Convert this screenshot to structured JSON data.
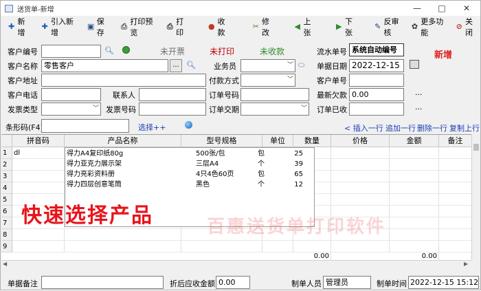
{
  "window": {
    "title": "送货单-新增",
    "minimize": "—",
    "maximize": "□",
    "close": "✕"
  },
  "toolbar": [
    {
      "label": "新增",
      "icon": "plus-icon",
      "glyph": "✚",
      "color": "#1a5fb4"
    },
    {
      "label": "引入新增",
      "icon": "import-plus-icon",
      "glyph": "✚",
      "color": "#1a5fb4"
    },
    {
      "label": "保存",
      "icon": "save-icon",
      "glyph": "▣",
      "color": "#2b4f8a"
    },
    {
      "label": "打印预览",
      "icon": "print-preview-icon",
      "glyph": "⎙",
      "color": "#555555"
    },
    {
      "label": "打印",
      "icon": "print-icon",
      "glyph": "⎙",
      "color": "#333333"
    },
    {
      "label": "收款",
      "icon": "collect-payment-icon",
      "glyph": "●",
      "color": "#c0392b"
    },
    {
      "label": "修改",
      "icon": "edit-icon",
      "glyph": "✂",
      "color": "#8a6d1a"
    },
    {
      "label": "上张",
      "icon": "previous-icon",
      "glyph": "◀",
      "color": "#2e8b2e"
    },
    {
      "label": "下张",
      "icon": "next-icon",
      "glyph": "▶",
      "color": "#2e8b2e"
    },
    {
      "label": "反审核",
      "icon": "unaudit-icon",
      "glyph": "✎",
      "color": "#1a3f7a"
    },
    {
      "label": "更多功能",
      "icon": "more-functions-icon",
      "glyph": "✿",
      "color": "#333333"
    },
    {
      "label": "关闭",
      "icon": "close-icon",
      "glyph": "⊘",
      "color": "#c0392b"
    }
  ],
  "form": {
    "customer_code_label": "客户编号",
    "customer_code": "",
    "invoice_status": "未开票",
    "print_status": "未打印",
    "payment_status": "未收款",
    "serial_label": "流水单号",
    "serial_value": "系统自动编号",
    "mode_badge": "新增",
    "customer_name_label": "客户名称",
    "customer_name": "零售客户",
    "browse_label": "...",
    "salesperson_label": "业务员",
    "salesperson": "",
    "date_label": "单据日期",
    "date_value": "2022-12-15",
    "customer_address_label": "客户地址",
    "customer_address": "",
    "payment_method_label": "付款方式",
    "payment_method": "",
    "customer_order_label": "客户单号",
    "customer_order": "",
    "customer_phone_label": "客户电话",
    "customer_phone": "",
    "contact_label": "联系人",
    "contact": "",
    "order_no_label": "订单号码",
    "order_no": "",
    "latest_debt_label": "最新欠款",
    "latest_debt": "0.00",
    "invoice_type_label": "发票类型",
    "invoice_type": "",
    "invoice_no_label": "发票号码",
    "invoice_no": "",
    "delivery_date_label": "订单交期",
    "delivery_date": "",
    "order_received_label": "订单已收",
    "order_received": "",
    "barcode_label": "条形码(F4)",
    "barcode": "",
    "select_more": "选择++",
    "insert_row": "< 插入一行",
    "append_row": "追加一行",
    "delete_row": "删除一行",
    "copy_up": "复制上行"
  },
  "grid": {
    "columns": [
      "拼音码",
      "产品名称",
      "型号规格",
      "单位",
      "数量",
      "价格",
      "金额",
      "备注"
    ],
    "row_numbers": [
      "1",
      "2",
      "3",
      "4",
      "5",
      "6",
      "7",
      "8",
      "9"
    ],
    "first_row_pinyin": "dl",
    "total_qty": "0.00",
    "total_amount": "0.00"
  },
  "popup": {
    "rows": [
      {
        "name": "得力A4复印纸80g",
        "spec": "500张/包",
        "unit": "包",
        "qty": "25"
      },
      {
        "name": "得力亚克力展示架",
        "spec": "三层A4",
        "unit": "个",
        "qty": "39"
      },
      {
        "name": "得力亮彩资料册",
        "spec": "4只4色60页",
        "unit": "包",
        "qty": "65"
      },
      {
        "name": "得力四层创意笔筒",
        "spec": "黑色",
        "unit": "个",
        "qty": "12"
      }
    ]
  },
  "overlay": {
    "callout": "快速选择产品",
    "watermark": "百惠送货单打印软件"
  },
  "footer": {
    "remark_label": "单据备注",
    "remark": "",
    "discount_label": "折后应收金额",
    "discount_value": "0.00",
    "maker_label": "制单人员",
    "maker": "管理员",
    "time_label": "制单时间",
    "time_value": "2022-12-15 15:12:36"
  },
  "colors": {
    "accent": "#1a3fb4",
    "red": "#e02020",
    "green": "#2e8b2e",
    "status_red": "#c00000"
  }
}
